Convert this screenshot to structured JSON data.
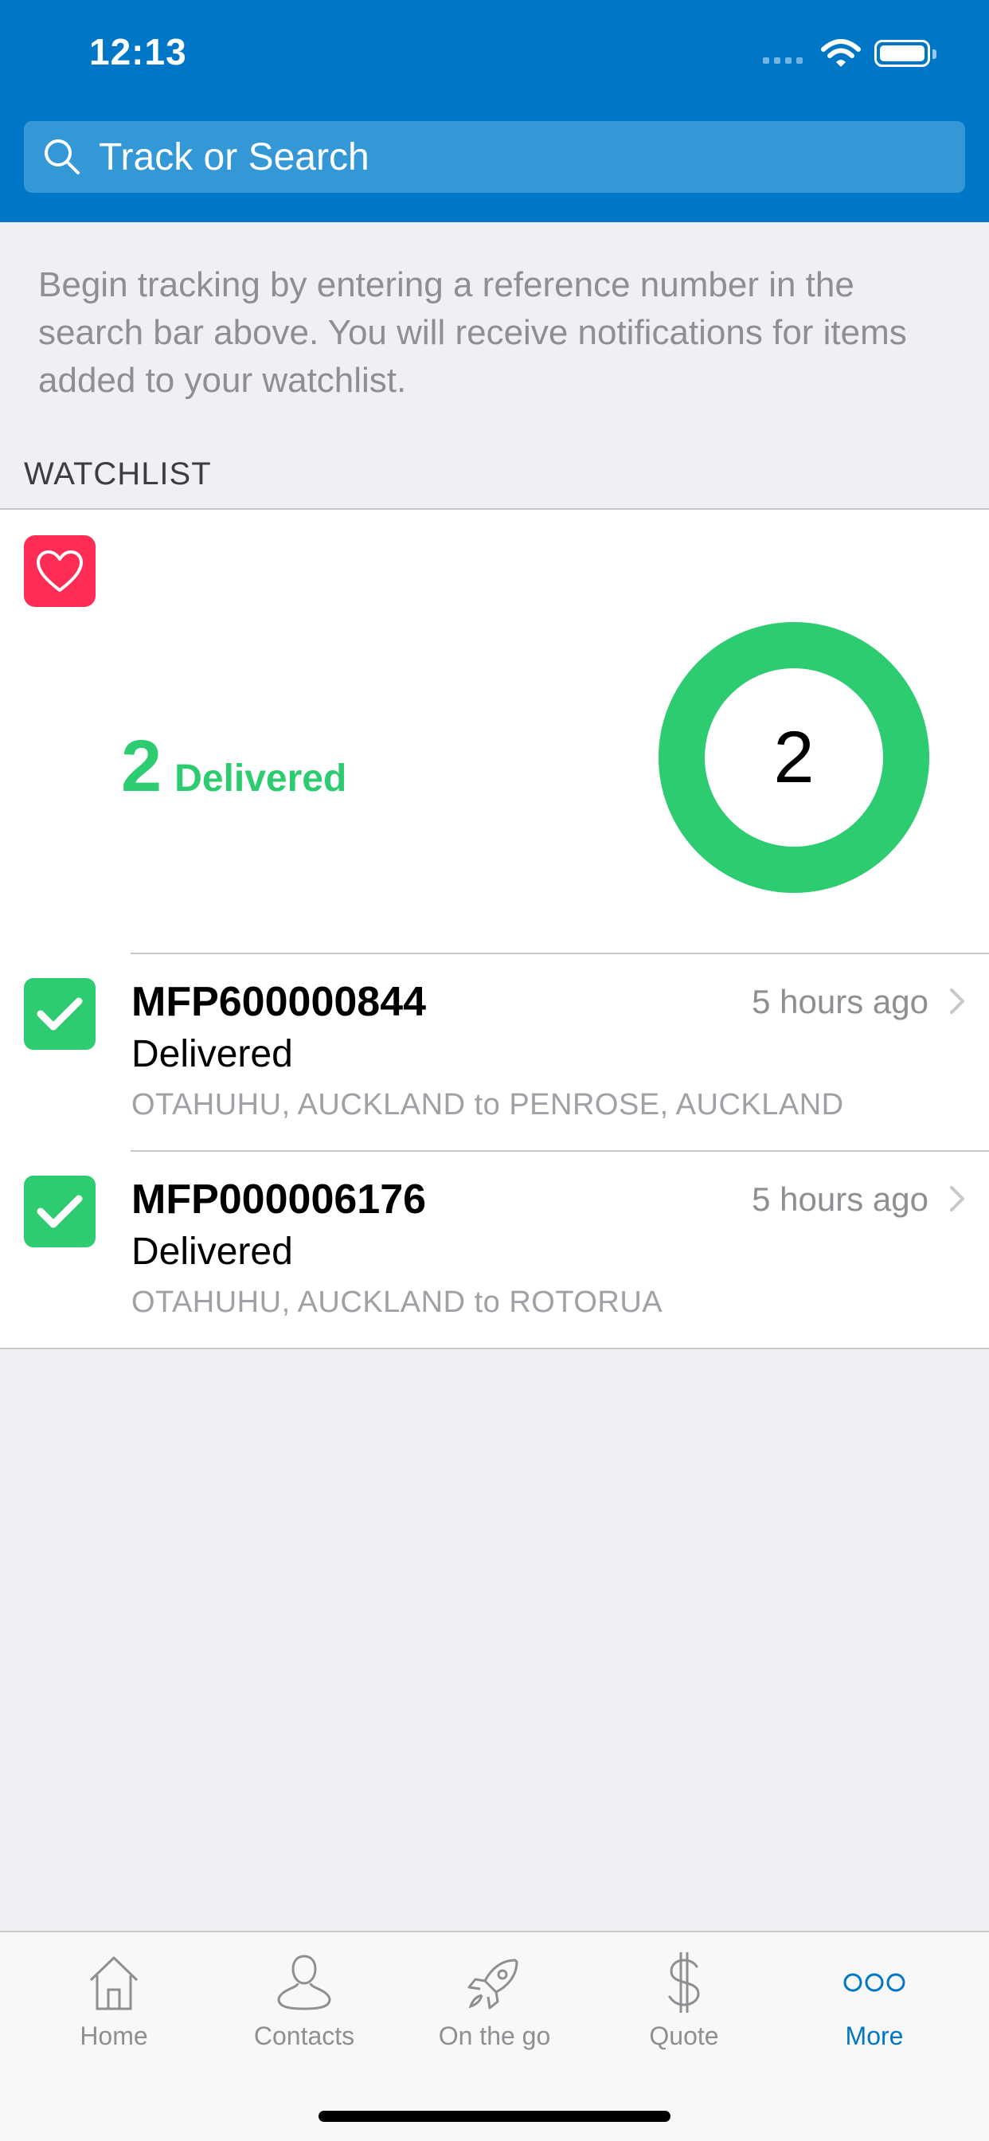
{
  "status_bar": {
    "time": "12:13"
  },
  "search": {
    "placeholder": "Track or Search"
  },
  "intro_text": "Begin tracking by entering a reference number in the search bar above. You will receive notifications for items added to your watchlist.",
  "watchlist": {
    "header": "WATCHLIST",
    "summary_count": "2",
    "summary_label": "Delivered",
    "donut_count": "2",
    "delivered_fraction": 1.0,
    "items": [
      {
        "reference": "MFP600000844",
        "time": "5 hours ago",
        "status": "Delivered",
        "route": "OTAHUHU, AUCKLAND to PENROSE, AUCKLAND"
      },
      {
        "reference": "MFP000006176",
        "time": "5 hours ago",
        "status": "Delivered",
        "route": "OTAHUHU, AUCKLAND to ROTORUA"
      }
    ]
  },
  "tabs": [
    {
      "label": "Home",
      "icon": "home-icon",
      "active": false
    },
    {
      "label": "Contacts",
      "icon": "person-icon",
      "active": false
    },
    {
      "label": "On the go",
      "icon": "rocket-icon",
      "active": false
    },
    {
      "label": "Quote",
      "icon": "dollar-icon",
      "active": false
    },
    {
      "label": "More",
      "icon": "more-icon",
      "active": true
    }
  ],
  "colors": {
    "header": "#0077c6",
    "search_bar": "#3498d6",
    "delivered_green": "#2ecc71",
    "heart_pink": "#ff2d55",
    "active_tab": "#0077c6"
  }
}
